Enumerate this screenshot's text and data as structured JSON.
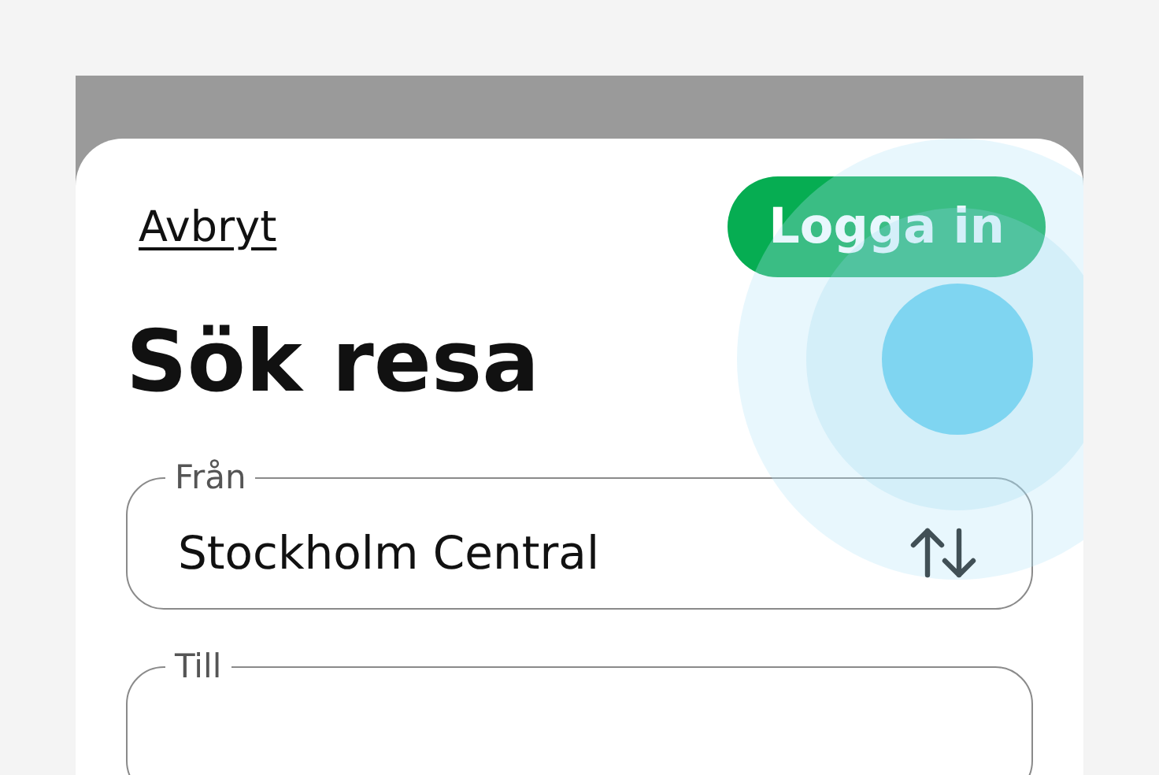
{
  "header": {
    "cancel_link": "Avbryt",
    "login_button": "Logga in"
  },
  "title": "Sök resa",
  "fields": [
    {
      "label": "Från",
      "value": "Stockholm Central",
      "kind": "swap"
    },
    {
      "label": "Till",
      "kind": "plain"
    }
  ]
}
